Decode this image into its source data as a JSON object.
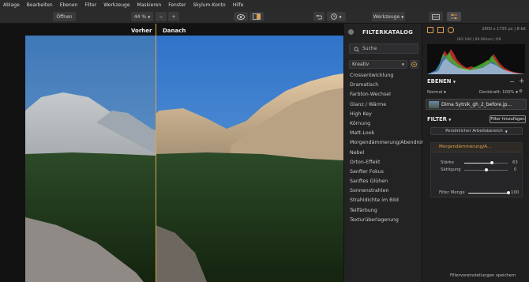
{
  "menu": [
    "Ablage",
    "Bearbeiten",
    "Ebenen",
    "Filter",
    "Werkzeuge",
    "Maskieren",
    "Fenster",
    "Skylum-Konto",
    "Hilfe"
  ],
  "toolbar": {
    "open_label": "Öffnen",
    "zoom_label": "44 %",
    "zoom_out": "−",
    "zoom_in": "+",
    "tools_label": "Werkzeuge"
  },
  "canvas": {
    "before_label": "Vorher",
    "after_label": "Danach"
  },
  "catalog": {
    "title": "FILTERKATALOG",
    "search_placeholder": "Suche",
    "category": "Kreativ",
    "filters": [
      "Crossentwicklung",
      "Dramatisch",
      "Farbton-Wechsel",
      "Glanz / Wärme",
      "High Key",
      "Körnung",
      "Matt-Look",
      "Morgendämmerung/Abendrot",
      "Nebel",
      "Orton-Effekt",
      "Sanfter Fokus",
      "Sanftes Glühen",
      "Sonnenstrahlen",
      "Strahldichte im Bild",
      "Teilfärbung",
      "Texturüberlagerung"
    ]
  },
  "info": {
    "dimensions": "2600 x 1735 px  |  8-bit",
    "exif": "ISO 100  |  60.00mm  |  f/8"
  },
  "layers": {
    "title": "EBENEN",
    "blend_mode": "Normal",
    "opacity_label": "Deckkraft: 100%",
    "layer_name": "Dima Sytnik_gh_2_before.jp..."
  },
  "filter_panel": {
    "title": "FILTER",
    "add_button": "Filter hinzufügen",
    "workspace": "Persönlicher Arbeitsbereich",
    "active_filter": "Morgendämmerung/A...",
    "strength_label": "Stärke",
    "strength_value": "63",
    "strength_fraction": 0.63,
    "saturation_label": "Sättigung",
    "saturation_value": "0",
    "saturation_fraction": 0.5,
    "amount_label": "Filter Menge",
    "amount_value": "100",
    "amount_fraction": 1.0
  },
  "footer": {
    "save_preset": "Filtervoreinstellungen speichern"
  },
  "colors": {
    "accent": "#e0a14a",
    "divider": "#d7a548"
  }
}
